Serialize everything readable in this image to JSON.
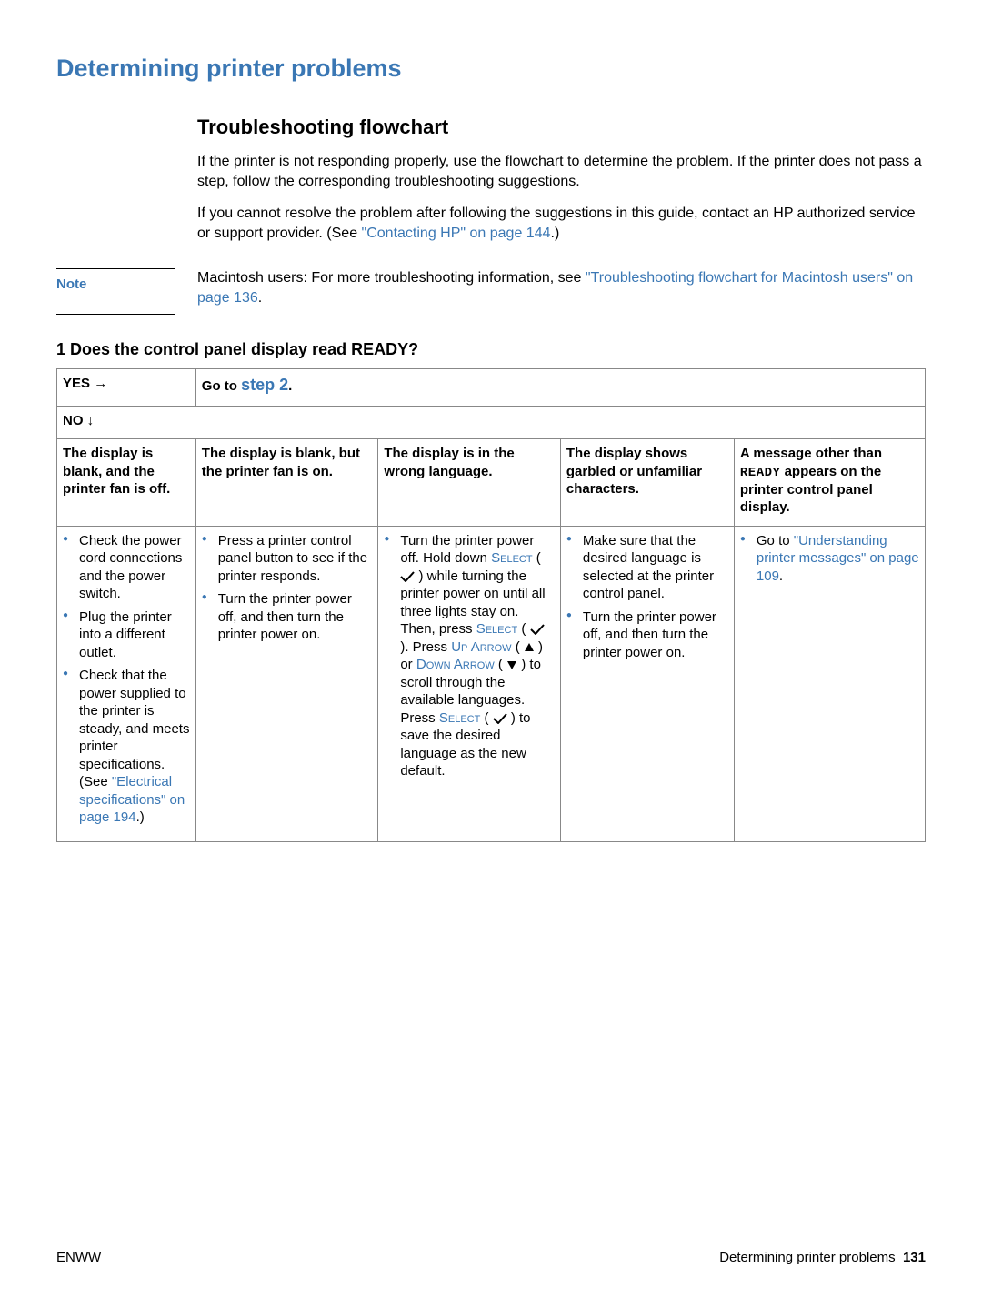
{
  "heading": "Determining printer problems",
  "subheading": "Troubleshooting flowchart",
  "intro1": "If the printer is not responding properly, use the flowchart to determine the problem. If the printer does not pass a step, follow the corresponding troubleshooting suggestions.",
  "intro2_pre": "If you cannot resolve the problem after following the suggestions in this guide, contact an HP authorized service or support provider. (See ",
  "intro2_link": "\"Contacting HP\" on page 144",
  "intro2_post": ".)",
  "note_label": "Note",
  "note_pre": "Macintosh users: For more troubleshooting information, see ",
  "note_link": "\"Troubleshooting flowchart for Macintosh users\" on page 136",
  "note_post": ".",
  "q1_title": "1 Does the control panel display read READY?",
  "yes_label": "YES",
  "no_label": "NO",
  "goto_pre": "Go to ",
  "goto_step": "step 2",
  "goto_post": ".",
  "col1_head": "The display is blank, and the printer fan is off.",
  "col2_head": "The display is blank, but the printer fan is on.",
  "col3_head": "The display is in the wrong language.",
  "col4_head": "The display shows garbled or unfamiliar characters.",
  "col5_head_pre": "A message other than ",
  "col5_head_mono": "READY",
  "col5_head_post": " appears on the printer control panel display.",
  "c1_i1": "Check the power cord connections and the power switch.",
  "c1_i2": "Plug the printer into a different outlet.",
  "c1_i3_pre": "Check that the power supplied to the printer is steady, and meets printer specifications. (See ",
  "c1_i3_link": "\"Electrical specifications\" on page 194",
  "c1_i3_post": ".)",
  "c2_i1": "Press a printer control panel button to see if the printer responds.",
  "c2_i2": "Turn the printer power off, and then turn the printer power on.",
  "c3_t1": "Turn the printer power off. Hold down ",
  "c3_select1": "Select",
  "c3_t2": " ( ",
  "c3_t3": " ) while turning the printer power on until all three lights stay on. Then, press ",
  "c3_select2": "Select",
  "c3_t4": " ( ",
  "c3_t5": " ). Press ",
  "c3_up": "Up Arrow",
  "c3_t6": " ( ",
  "c3_t7": " ) or ",
  "c3_down": "Down Arrow",
  "c3_t8": " ( ",
  "c3_t9": " ) to scroll through the available languages. Press ",
  "c3_select3": "Select",
  "c3_t10": " ( ",
  "c3_t11": " ) to save the desired language as the new default.",
  "c4_i1": "Make sure that the desired language is selected at the printer control panel.",
  "c4_i2": "Turn the printer power off, and then turn the printer power on.",
  "c5_pre": "Go to ",
  "c5_link": "\"Understanding printer messages\" on page 109",
  "c5_post": ".",
  "footer_left": "ENWW",
  "footer_right_text": "Determining printer problems",
  "footer_page": "131"
}
